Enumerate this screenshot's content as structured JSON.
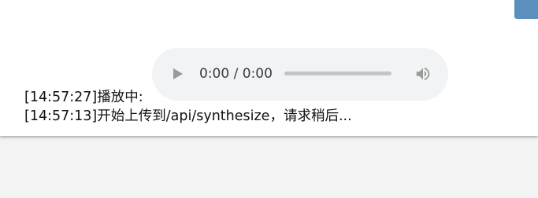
{
  "colors": {
    "page_background": "#f3f3f3",
    "panel_background": "#ffffff",
    "accent_tab": "#5b8fbe",
    "player_background": "#f1f3f4"
  },
  "audio_player": {
    "time_display": "0:00 / 0:00",
    "progress": 0,
    "play_icon": "play-icon",
    "volume_icon": "volume-icon"
  },
  "log": {
    "lines": [
      "[14:57:27]播放中:",
      "[14:57:13]开始上传到/api/synthesize，请求稍后..."
    ]
  }
}
